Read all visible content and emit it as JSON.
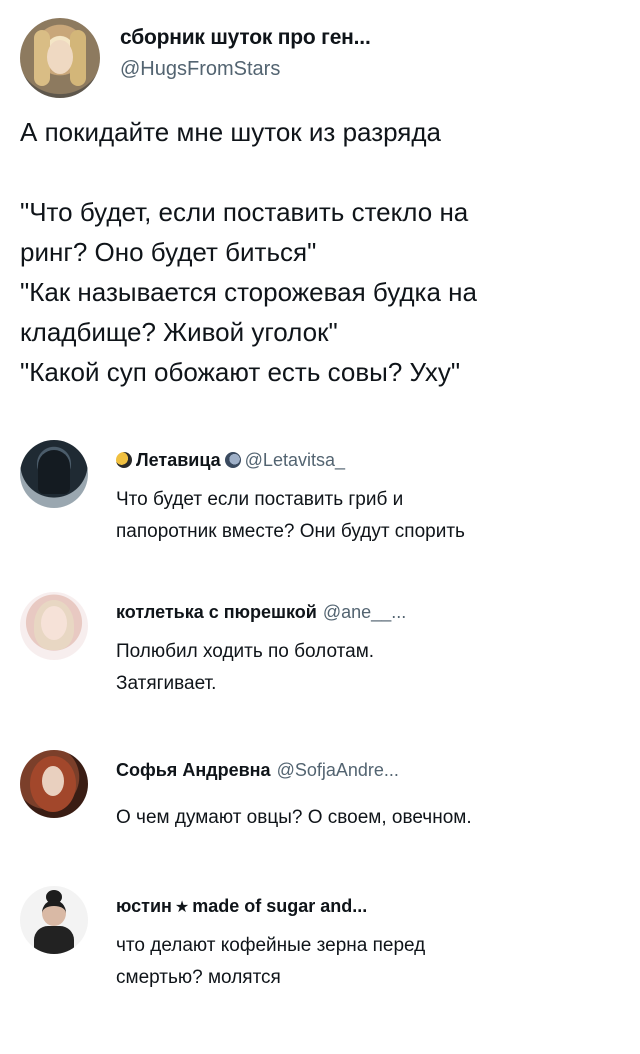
{
  "main_tweet": {
    "author_name": "сборник шуток про ген...",
    "author_handle": "@HugsFromStars",
    "lines": [
      "А покидайте мне шуток из разряда",
      "",
      "\"Что будет, если поставить стекло на",
      "ринг? Оно будет биться\"",
      "\"Как называется сторожевая будка на",
      "кладбище? Живой уголок\"",
      "\"Какой суп обожают есть совы? Уху\""
    ]
  },
  "replies": [
    {
      "name": "Летавица",
      "handle": "@Letavitsa_",
      "avatar_icon": "hooded-figure-avatar",
      "lines": [
        "Что будет если поставить гриб и",
        "папоротник вместе? Они будут спорить"
      ]
    },
    {
      "name": "котлетька с пюрешкой",
      "handle": "@ane__...",
      "avatar_icon": "blonde-girl-avatar",
      "lines": [
        "Полюбил ходить по болотам.",
        "Затягивает."
      ]
    },
    {
      "name": "Софья Андревна",
      "handle": "@SofjaAndre...",
      "avatar_icon": "red-hair-avatar",
      "lines": [
        "О чем думают овцы? О своем, овечном."
      ]
    },
    {
      "name_prefix": "юстин",
      "name_symbol": "★",
      "name_suffix": "made of sugar and...",
      "avatar_icon": "girl-with-bun-avatar",
      "lines": [
        "что делают кофейные зерна перед",
        "смертью? молятся"
      ]
    }
  ],
  "colors": {
    "text": "#0f1419",
    "secondary": "#536471",
    "background": "#ffffff"
  }
}
